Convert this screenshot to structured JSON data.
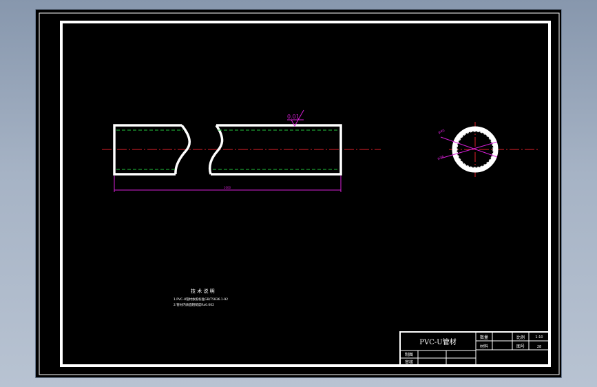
{
  "drawing": {
    "title": "PVC-U管材",
    "tolerance_value": "0.01",
    "length_dim": "1000",
    "diam_outer_dim": "φ40",
    "diam_inner_dim": "φ36"
  },
  "notes": {
    "heading": "技 术 说 明",
    "line1": "1.PVC-U管材依照标准GB/T5836.1-92",
    "line2": "2.管材内表面粗糙度Ra0.002"
  },
  "title_block": {
    "name": "PVC-U管材",
    "batch_label": "数量",
    "scale_label": "比例",
    "scale_value": "1:10",
    "material_label": "材料",
    "drawing_no_label": "图号",
    "drawing_no_value": "28",
    "drawn_label": "制图",
    "checked_label": "审核"
  },
  "colors": {
    "outline": "#ffffff",
    "center_line": "#e0202a",
    "hidden_line": "#22c43c",
    "dimension": "#d81fd8"
  }
}
